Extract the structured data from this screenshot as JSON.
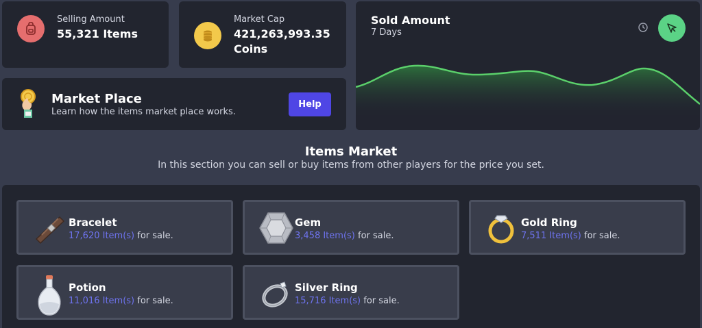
{
  "stats": {
    "selling": {
      "label": "Selling Amount",
      "value": "55,321 Items",
      "icon": "backpack-icon",
      "color": "#e56e6e"
    },
    "market_cap": {
      "label": "Market Cap",
      "value_line1": "421,263,993.35",
      "value_line2": "Coins",
      "icon": "coins-icon",
      "color": "#f3c94b"
    }
  },
  "sold_chart": {
    "title": "Sold Amount",
    "subtitle": "7 Days",
    "accent": "#5bd06b",
    "action_icon": "cursor-arrow-icon",
    "time_icon": "clock-icon"
  },
  "marketplace_banner": {
    "title": "Market Place",
    "description": "Learn how the items market place works.",
    "button_label": "Help",
    "icon": "hand-coin-icon",
    "button_color": "#4f46e5"
  },
  "items_market": {
    "title": "Items Market",
    "subtitle": "In this section you can sell or buy items from other players for the price you set.",
    "items": [
      {
        "name": "Bracelet",
        "count": "17,620 Item(s)",
        "suffix": "for sale.",
        "icon": "bracelet-icon"
      },
      {
        "name": "Gem",
        "count": "3,458 Item(s)",
        "suffix": "for sale.",
        "icon": "gem-icon"
      },
      {
        "name": "Gold Ring",
        "count": "7,511 Item(s)",
        "suffix": "for sale.",
        "icon": "gold-ring-icon"
      },
      {
        "name": "Potion",
        "count": "11,016 Item(s)",
        "suffix": "for sale.",
        "icon": "potion-icon"
      },
      {
        "name": "Silver Ring",
        "count": "15,716 Item(s)",
        "suffix": "for sale.",
        "icon": "silver-ring-icon"
      }
    ]
  }
}
